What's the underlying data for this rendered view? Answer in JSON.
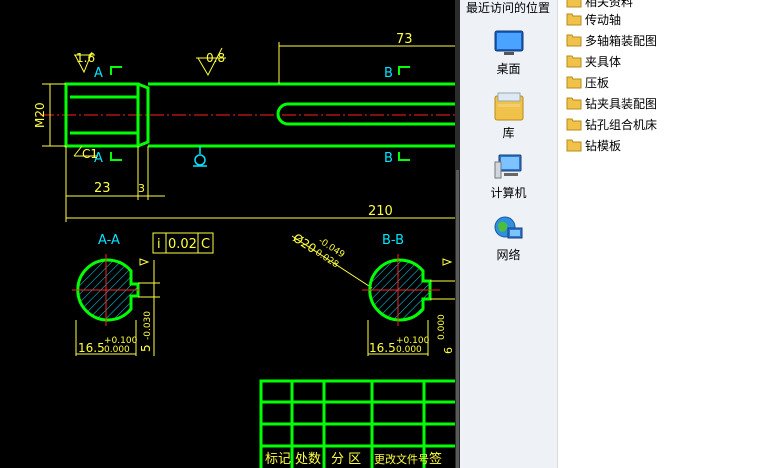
{
  "drawing": {
    "dim_73": "73",
    "rough_16": "1.6",
    "rough_08": "0.8",
    "sec_a_top": "A",
    "sec_b_top": "B",
    "sec_a_bot": "A",
    "sec_b_bot": "B",
    "m20": "M20",
    "c1": "C1",
    "dim_23": "23",
    "dim_3": "3",
    "dim_210": "210",
    "view_aa": "A-A",
    "view_bb": "B-B",
    "tol_sym": "i",
    "tol_val": "0.02",
    "tol_ref": "C",
    "dia_20": "Ø20",
    "dia_20_upper": "-0.049",
    "dia_20_lower": "-0.028",
    "aa_165": "16.5",
    "aa_165_upper": "+0.100",
    "aa_165_lower": "0.000",
    "aa_5": "5",
    "aa_5_tol": "-0.030",
    "aa_5_tol2": "0.000",
    "bb_165": "16.5",
    "bb_165_upper": "+0.100",
    "bb_165_lower": "0.000",
    "bb_6_tol": "0.000",
    "bb_6": "6",
    "tb_h1": "标记",
    "tb_h2": "处数",
    "tb_h3": "分 区",
    "tb_h4": "更改文件号",
    "tb_h5": "签"
  },
  "nav": {
    "recent": "最近访问的位置",
    "items": [
      {
        "label": "桌面",
        "icon": "desktop-icon"
      },
      {
        "label": "库",
        "icon": "library-icon"
      },
      {
        "label": "计算机",
        "icon": "computer-icon"
      },
      {
        "label": "网络",
        "icon": "network-icon"
      }
    ]
  },
  "files": {
    "items": [
      {
        "label": "相关资料",
        "icon": "folder-icon"
      },
      {
        "label": "传动轴",
        "icon": "folder-icon"
      },
      {
        "label": "多轴箱装配图",
        "icon": "folder-icon"
      },
      {
        "label": "夹具体",
        "icon": "folder-icon"
      },
      {
        "label": "压板",
        "icon": "folder-icon"
      },
      {
        "label": "钻夹具装配图",
        "icon": "folder-icon"
      },
      {
        "label": "钻孔组合机床",
        "icon": "folder-icon"
      },
      {
        "label": "钻模板",
        "icon": "folder-icon"
      }
    ]
  },
  "colors": {
    "cad_bg": "#000000",
    "cad_green": "#00ff00",
    "cad_yellow": "#ffff40",
    "cad_cyan": "#00e5ff",
    "cad_red": "#ff2020",
    "folder": "#f0c24a"
  }
}
